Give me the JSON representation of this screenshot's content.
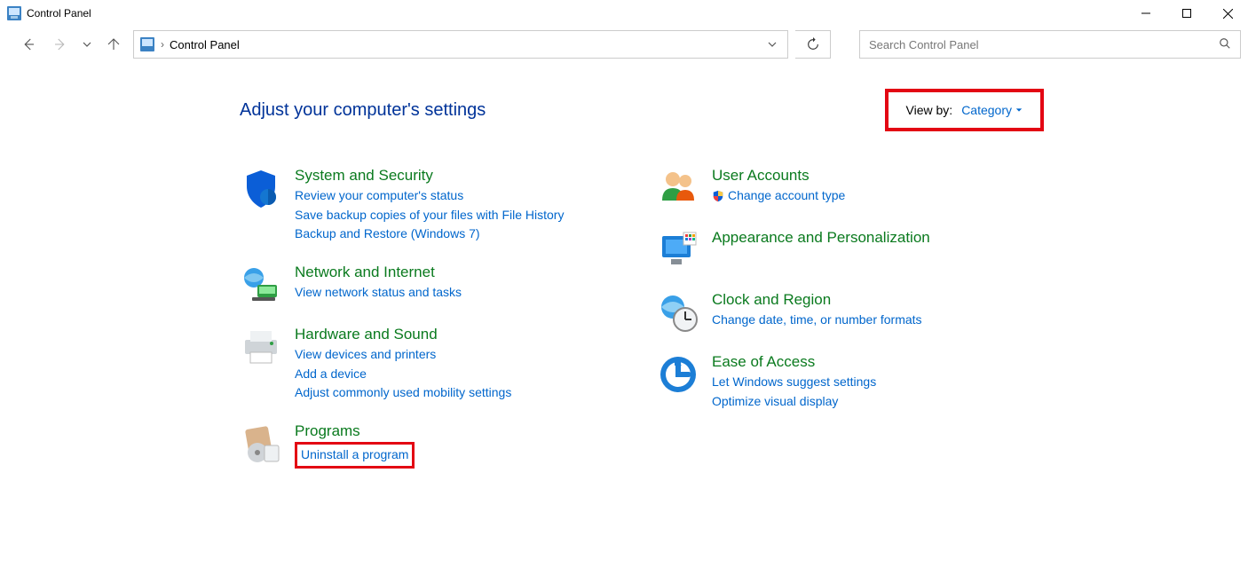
{
  "window": {
    "title": "Control Panel"
  },
  "address": {
    "location": "Control Panel"
  },
  "search": {
    "placeholder": "Search Control Panel"
  },
  "heading": "Adjust your computer's settings",
  "viewby": {
    "label": "View by:",
    "value": "Category"
  },
  "left_categories": [
    {
      "icon": "shield",
      "title": "System and Security",
      "links": [
        "Review your computer's status",
        "Save backup copies of your files with File History",
        "Backup and Restore (Windows 7)"
      ]
    },
    {
      "icon": "network",
      "title": "Network and Internet",
      "links": [
        "View network status and tasks"
      ]
    },
    {
      "icon": "printer",
      "title": "Hardware and Sound",
      "links": [
        "View devices and printers",
        "Add a device",
        "Adjust commonly used mobility settings"
      ]
    },
    {
      "icon": "programs",
      "title": "Programs",
      "links": [
        "Uninstall a program"
      ],
      "highlight_first": true
    }
  ],
  "right_categories": [
    {
      "icon": "users",
      "title": "User Accounts",
      "links": [
        "Change account type"
      ],
      "shield_first": true
    },
    {
      "icon": "appearance",
      "title": "Appearance and Personalization",
      "links": []
    },
    {
      "icon": "clock",
      "title": "Clock and Region",
      "links": [
        "Change date, time, or number formats"
      ]
    },
    {
      "icon": "ease",
      "title": "Ease of Access",
      "links": [
        "Let Windows suggest settings",
        "Optimize visual display"
      ]
    }
  ]
}
